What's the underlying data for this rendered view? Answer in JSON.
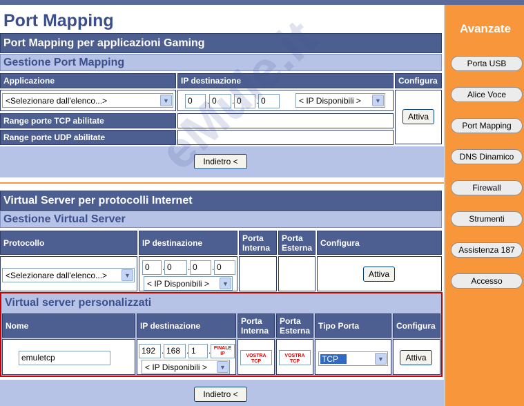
{
  "page_title": "Port Mapping",
  "gaming": {
    "header": "Port Mapping per applicazioni Gaming",
    "subheader": "Gestione Port Mapping",
    "col_app": "Applicazione",
    "col_ip": "IP destinazione",
    "col_config": "Configura",
    "app_select": "<Selezionare dall'elenco...>",
    "ip": [
      "0",
      "0",
      "0",
      "0"
    ],
    "ip_select": "< IP Disponibili >",
    "activate": "Attiva",
    "tcp_label": "Range porte TCP abilitate",
    "udp_label": "Range porte UDP abilitate",
    "back": "Indietro <"
  },
  "vserver": {
    "header": "Virtual Server per protocolli Internet",
    "subheader": "Gestione Virtual Server",
    "col_proto": "Protocollo",
    "col_ip": "IP destinazione",
    "col_int_1": "Porta",
    "col_int_2": "Interna",
    "col_ext_1": "Porta",
    "col_ext_2": "Esterna",
    "col_config": "Configura",
    "proto_select": "<Selezionare dall'elenco...>",
    "ip": [
      "0",
      "0",
      "0",
      "0"
    ],
    "ip_select": "< IP Disponibili >",
    "activate": "Attiva"
  },
  "custom": {
    "header": "Virtual server personalizzati",
    "col_name": "Nome",
    "col_ip": "IP destinazione",
    "col_int_1": "Porta",
    "col_int_2": "Interna",
    "col_ext_1": "Porta",
    "col_ext_2": "Esterna",
    "col_type": "Tipo Porta",
    "col_config": "Configura",
    "name_value": "emuletcp",
    "ip": [
      "192",
      "168",
      "1"
    ],
    "finale_1": "FINALE",
    "finale_2": "IP",
    "ip_select": "< IP Disponibili >",
    "vostra_1": "VOSTRA",
    "vostra_2": "TCP",
    "type_value": "TCP",
    "activate": "Attiva",
    "back": "Indietro <"
  },
  "sidebar": {
    "title": "Avanzate",
    "items": [
      "Porta USB",
      "Alice Voce",
      "Port Mapping",
      "DNS Dinamico",
      "Firewall",
      "Strumenti",
      "Assistenza 187",
      "Accesso"
    ]
  },
  "watermark": "eMule.it",
  "colors": {
    "header": "#4d5f91",
    "sub": "#b7c3e6",
    "sidebar": "#f7963a",
    "highlight": "#cc0000"
  }
}
